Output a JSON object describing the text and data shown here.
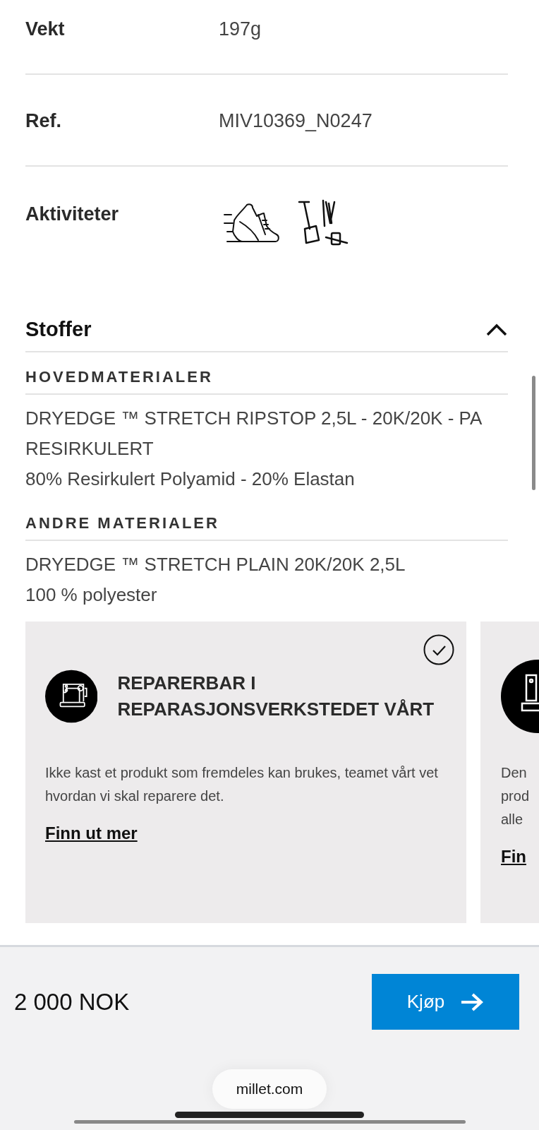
{
  "specs": [
    {
      "kind": "text",
      "label": "Vekt",
      "value": "197g"
    },
    {
      "kind": "text",
      "label": "Ref.",
      "value": "MIV10369_N0247"
    },
    {
      "kind": "activities",
      "label": "Aktiviteter"
    }
  ],
  "fabrics": {
    "title": "Stoffer",
    "expanded": true,
    "sections": [
      {
        "heading": "HOVEDMATERIALER",
        "lines": [
          "DRYEDGE ™ STRETCH RIPSTOP 2,5L - 20K/20K - PA RESIRKULERT",
          "80% Resirkulert Polyamid - 20% Elastan"
        ]
      },
      {
        "heading": "ANDRE MATERIALER",
        "lines": [
          "DRYEDGE ™ STRETCH PLAIN 20K/20K 2,5L",
          "100 % polyester"
        ]
      }
    ]
  },
  "cards": [
    {
      "title": "REPARERBAR I REPARASJONSVERKSTEDET VÅRT",
      "checked": true,
      "description": "Ikke kast et produkt som fremdeles kan brukes, teamet vårt vet hvordan vi skal reparere det.",
      "link": "Finn ut mer"
    },
    {
      "description_lines": [
        "Den",
        "prod",
        "alle"
      ],
      "link": "Fin"
    }
  ],
  "purchase_bar": {
    "price": "2 000 NOK",
    "button": "Kjøp"
  },
  "address_bar": {
    "url": "millet.com"
  }
}
